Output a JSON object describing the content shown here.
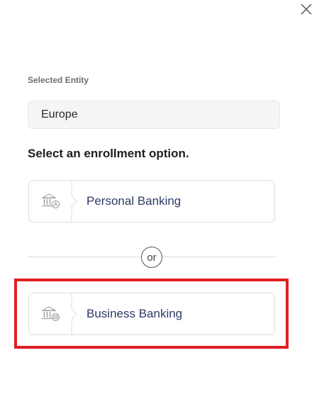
{
  "dialog": {
    "close_icon": "close-icon"
  },
  "entity": {
    "label": "Selected Entity",
    "value": "Europe"
  },
  "prompt": "Select an enrollment option.",
  "options": [
    {
      "label": "Personal Banking",
      "icon": "bank-personal-icon"
    },
    {
      "label": "Business Banking",
      "icon": "bank-business-icon"
    }
  ],
  "divider": {
    "text": "or"
  },
  "colors": {
    "option_text": "#2e3a68",
    "highlight": "#e21d24",
    "field_background": "#f5f5f5"
  }
}
